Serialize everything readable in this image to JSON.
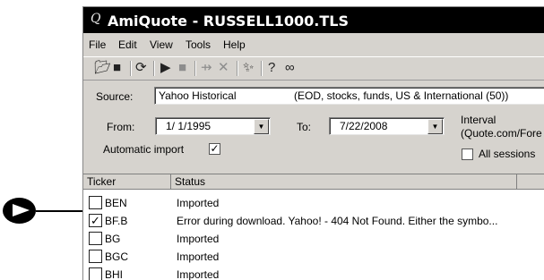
{
  "window": {
    "title": "AmiQuote - RUSSELL1000.TLS",
    "title_icon": "Q"
  },
  "menu": [
    "File",
    "Edit",
    "View",
    "Tools",
    "Help"
  ],
  "toolbar_icons": [
    "open-folder-icon",
    "save-icon",
    "refresh-icon",
    "play-icon",
    "stop-icon",
    "arrow-split-icon",
    "close-x-icon",
    "wizard-icon",
    "help-icon",
    "binoculars-icon"
  ],
  "source": {
    "label": "Source:",
    "value": "Yahoo Historical",
    "description": "(EOD, stocks, funds, US & International (50))"
  },
  "date_range": {
    "from_label": "From:",
    "from_value": "1/ 1/1995",
    "to_label": "To:",
    "to_value": "7/22/2008"
  },
  "interval": {
    "label_line1": "Interval",
    "label_line2": "(Quote.com/Fore"
  },
  "automatic_import": {
    "label": "Automatic import",
    "checked": true
  },
  "all_sessions": {
    "label": "All sessions",
    "checked": false
  },
  "table": {
    "columns": [
      "Ticker",
      "Status"
    ],
    "rows": [
      {
        "ticker": "BEN",
        "status": "Imported",
        "checked": false
      },
      {
        "ticker": "BF.B",
        "status": "Error during download. Yahoo! - 404 Not Found. Either the symbo...",
        "checked": true
      },
      {
        "ticker": "BG",
        "status": "Imported",
        "checked": false
      },
      {
        "ticker": "BGC",
        "status": "Imported",
        "checked": false
      },
      {
        "ticker": "BHI",
        "status": "Imported",
        "checked": false
      }
    ]
  },
  "checkmark": "✓"
}
